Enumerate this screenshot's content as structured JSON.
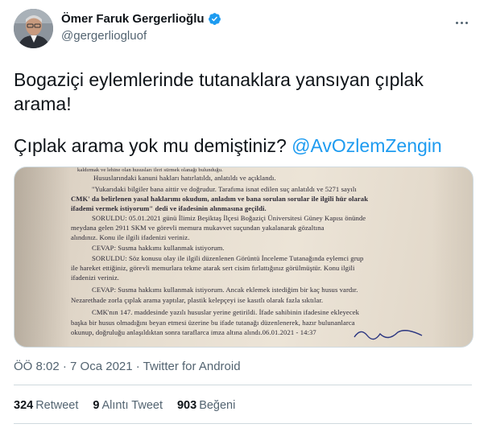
{
  "author": {
    "name": "Ömer Faruk Gergerlioğlu",
    "handle": "@gergerliogluof"
  },
  "tweet": {
    "line1": "Bogaziçi eylemlerinde tutanaklara yansıyan çıplak arama!",
    "line2_prefix": "Çıplak arama yok mu demiştiniz? ",
    "mention": "@AvOzlemZengin"
  },
  "document_lines": [
    "kaldırmak ve lehine olan hususları ileri sürmek olanağı bulunduğu.",
    "Hususlarındaki kanuni hakları hatırlatıldı, anlatıldı ve açıklandı.",
    "\"Yukarıdaki bilgiler bana aittir ve doğrudur. Tarafıma isnat edilen suç anlatıldı ve 5271 sayılı",
    "CMK' da belirlenen yasal haklarımı okudum, anladım ve bana sorulan sorular ile ilgili hür olarak",
    "ifademi vermek istiyorum\" dedi ve ifadesinin alınmasına geçildi.",
    "SORULDU: 05.01.2021 günü İlimiz Beşiktaş İlçesi Boğaziçi Üniversitesi Güney Kapısı önünde",
    "meydana gelen 2911 SKM ve görevli memura mukavvet suçundan yakalanarak gözaltına",
    "alındınız. Konu ile ilgili ifadenizi veriniz.",
    "CEVAP: Susma hakkımı kullanmak istiyorum.",
    "SORULDU: Söz konusu olay ile ilgili düzenlenen Görüntü İnceleme Tutanağında eylemci grup",
    "ile hareket ettiğiniz, görevli memurlara tekme atarak sert cisim fırlattığınız görülmüştür. Konu ilgili",
    "ifadenizi veriniz.",
    "CEVAP: Susma hakkımı kullanmak istiyorum. Ancak eklemek istediğim bir kaç husus vardır.",
    "Nezarethade zorla çıplak arama yaptılar, plastik kelepçeyi ise kasıtlı olarak fazla sıktılar.",
    "CMK'nın 147. maddesinde yazılı hususlar yerine getirildi. İfade sahibinin ifadesine ekleyecek",
    "başka bir husus olmadığını beyan etmesi üzerine bu ifade tutanağı düzenlenerek, hazır bulunanlarca",
    "okunup, doğruluğu anlaşıldıktan sonra taraflarca imza altına alındı.06.01.2021 - 14:37"
  ],
  "meta": {
    "time": "ÖÖ 8:02",
    "sep1": " · ",
    "date": "7 Oca 2021",
    "sep2": " · ",
    "source": "Twitter for Android"
  },
  "stats": {
    "retweets_count": "324",
    "retweets_label": "Retweet",
    "quotes_count": "9",
    "quotes_label": "Alıntı Tweet",
    "likes_count": "903",
    "likes_label": "Beğeni"
  },
  "colors": {
    "accent": "#1d9bf0",
    "text": "#0f1419",
    "muted": "#536471",
    "border": "#cfd9de"
  },
  "icons": [
    "verified-badge-icon",
    "more-options-icon"
  ]
}
